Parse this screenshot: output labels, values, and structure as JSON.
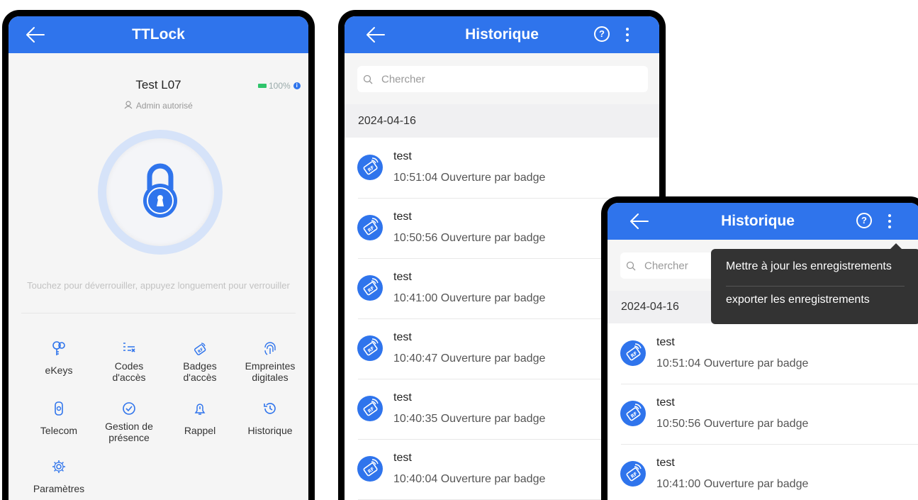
{
  "home": {
    "title": "TTLock",
    "lock_name": "Test L07",
    "battery": "100%",
    "admin_label": "Admin autorisé",
    "hint": "Touchez pour déverrouiller, appuyez longuement pour verrouiller",
    "features": [
      {
        "label": "eKeys",
        "icon": "ekey-icon"
      },
      {
        "label": "Codes\nd'accès",
        "icon": "passcode-icon"
      },
      {
        "label": "Badges\nd'accès",
        "icon": "rf-card-icon"
      },
      {
        "label": "Empreintes\ndigitales",
        "icon": "fingerprint-icon"
      },
      {
        "label": "Telecom",
        "icon": "remote-icon"
      },
      {
        "label": "Gestion de\nprésence",
        "icon": "attendance-icon"
      },
      {
        "label": "Rappel",
        "icon": "bell-icon"
      },
      {
        "label": "Historique",
        "icon": "history-icon"
      },
      {
        "label": "Paramètres",
        "icon": "gear-icon"
      }
    ]
  },
  "history": {
    "title": "Historique",
    "search_placeholder": "Chercher",
    "date": "2024-04-16",
    "records": [
      {
        "name": "test",
        "detail": "10:51:04 Ouverture par badge"
      },
      {
        "name": "test",
        "detail": "10:50:56 Ouverture par badge"
      },
      {
        "name": "test",
        "detail": "10:41:00 Ouverture par badge"
      },
      {
        "name": "test",
        "detail": "10:40:47 Ouverture par badge"
      },
      {
        "name": "test",
        "detail": "10:40:35 Ouverture par badge"
      },
      {
        "name": "test",
        "detail": "10:40:04 Ouverture par badge"
      }
    ]
  },
  "history_menu": {
    "title": "Historique",
    "search_placeholder": "Chercher",
    "date": "2024-04-16",
    "menu_items": [
      "Mettre à jour les enregistrements",
      "exporter les enregistrements"
    ],
    "records": [
      {
        "name": "test",
        "detail": "10:51:04 Ouverture par badge"
      },
      {
        "name": "test",
        "detail": "10:50:56 Ouverture par badge"
      },
      {
        "name": "test",
        "detail": "10:41:00 Ouverture par badge"
      }
    ]
  },
  "colors": {
    "primary": "#2f74ec",
    "menu_bg": "#333333",
    "battery": "#2fc46b"
  }
}
